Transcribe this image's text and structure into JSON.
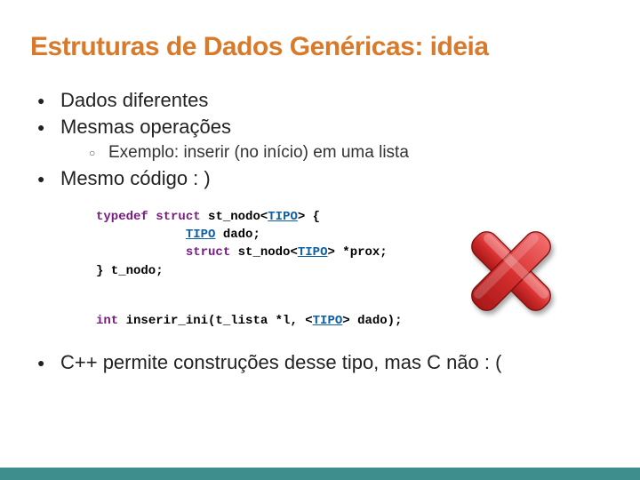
{
  "title": "Estruturas de Dados Genéricas: ideia",
  "bullets": {
    "b1": "Dados diferentes",
    "b2": "Mesmas operações",
    "b2sub": "Exemplo: inserir (no início) em uma lista",
    "b3": "Mesmo código : )",
    "b4": "C++ permite construções desse tipo, mas C não : ("
  },
  "code": {
    "kw_typedef": "typedef",
    "kw_struct1": "struct",
    "ident1": " st_nodo<",
    "tipo": "TIPO",
    "gt_open": "> {",
    "line2a": "            ",
    "line2b": " dado;",
    "line3a": "            ",
    "kw_struct2": "struct",
    "line3b": " st_nodo<",
    "line3c": "> *prox;",
    "line4": "} t_nodo;",
    "kw_int": "int",
    "fn": " inserir_ini(t_lista *l, <",
    "fn_end": "> dado);"
  },
  "icon": {
    "name": "red-cross"
  },
  "colors": {
    "accent": "#d97a2b",
    "bar": "#3d8e8c",
    "kw": "#781c81",
    "tipo": "#0d5fa8"
  }
}
